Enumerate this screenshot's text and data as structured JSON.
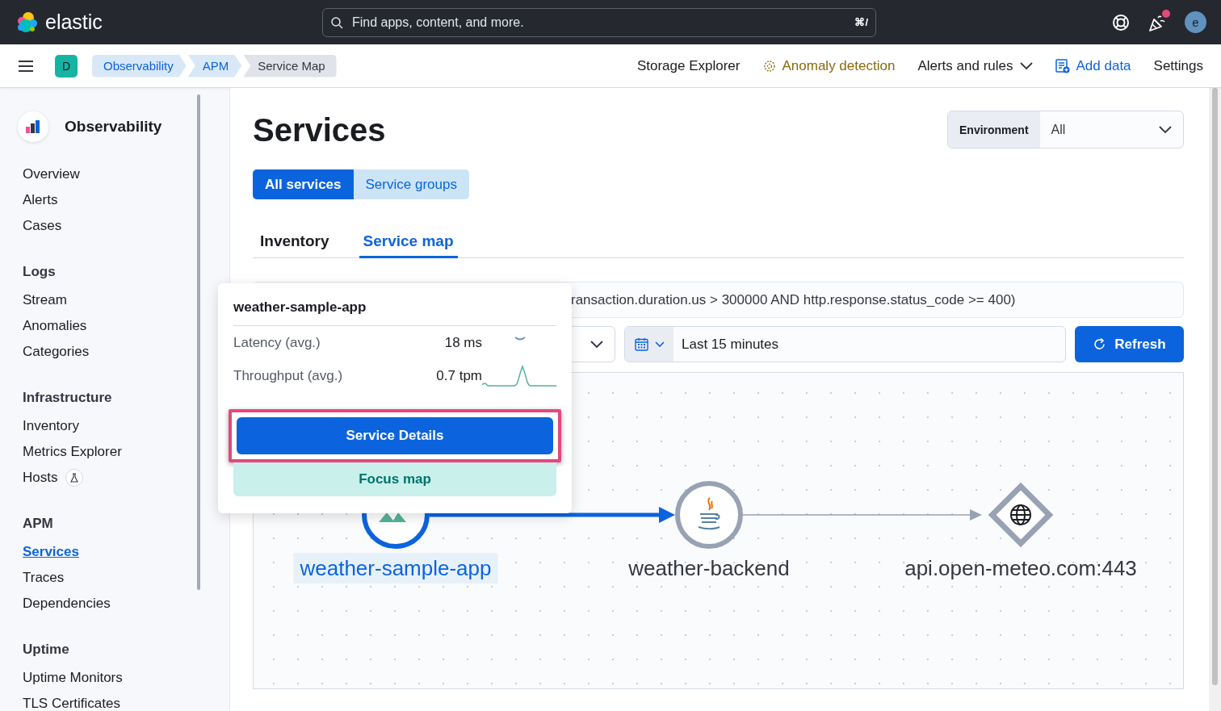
{
  "top_bar": {
    "brand": "elastic",
    "search": {
      "placeholder": "Find apps, content, and more.",
      "shortcut": "⌘/"
    },
    "news_unread": true,
    "avatar": "e"
  },
  "nav_bar": {
    "space": "D",
    "breadcrumbs": [
      "Observability",
      "APM",
      "Service Map"
    ],
    "links": [
      {
        "label": "Storage Explorer",
        "kind": "plain"
      },
      {
        "label": "Anomaly detection",
        "kind": "ml"
      },
      {
        "label": "Alerts and rules",
        "kind": "menu"
      },
      {
        "label": "Add data",
        "kind": "add"
      },
      {
        "label": "Settings",
        "kind": "plain"
      }
    ]
  },
  "sidebar": {
    "title": "Observability",
    "sections": [
      {
        "items": [
          {
            "label": "Overview",
            "selected": false,
            "beta": false
          },
          {
            "label": "Alerts",
            "selected": false,
            "beta": false
          },
          {
            "label": "Cases",
            "selected": false,
            "beta": false
          }
        ]
      },
      {
        "title": "Logs",
        "items": [
          {
            "label": "Stream",
            "selected": false,
            "beta": false
          },
          {
            "label": "Anomalies",
            "selected": false,
            "beta": false
          },
          {
            "label": "Categories",
            "selected": false,
            "beta": false
          }
        ]
      },
      {
        "title": "Infrastructure",
        "items": [
          {
            "label": "Inventory",
            "selected": false,
            "beta": false
          },
          {
            "label": "Metrics Explorer",
            "selected": false,
            "beta": false
          },
          {
            "label": "Hosts",
            "selected": false,
            "beta": true
          }
        ]
      },
      {
        "title": "APM",
        "items": [
          {
            "label": "Services",
            "selected": true,
            "beta": false
          },
          {
            "label": "Traces",
            "selected": false,
            "beta": false
          },
          {
            "label": "Dependencies",
            "selected": false,
            "beta": false
          }
        ]
      },
      {
        "title": "Uptime",
        "items": [
          {
            "label": "Uptime Monitors",
            "selected": false,
            "beta": false
          },
          {
            "label": "TLS Certificates",
            "selected": false,
            "beta": false
          }
        ]
      }
    ]
  },
  "main": {
    "title": "Services",
    "environment": {
      "label": "Environment",
      "value": "All"
    },
    "view_toggle": [
      {
        "label": "All services",
        "selected": true
      },
      {
        "label": "Service groups",
        "selected": false
      }
    ],
    "tabs": [
      {
        "label": "Inventory",
        "selected": false
      },
      {
        "label": "Service map",
        "selected": true
      }
    ],
    "query": "ransaction.duration.us > 300000 AND http.response.status_code >= 400)",
    "time_range": "Last 15 minutes",
    "refresh": "Refresh",
    "service_map": {
      "nodes": [
        {
          "label": "weather-sample-app",
          "kind": "service",
          "selected": true
        },
        {
          "label": "weather-backend",
          "kind": "java",
          "selected": false
        },
        {
          "label": "api.open-meteo.com:443",
          "kind": "external",
          "selected": false
        }
      ]
    },
    "popover": {
      "title": "weather-sample-app",
      "stats": [
        {
          "label": "Latency (avg.)",
          "value": "18 ms"
        },
        {
          "label": "Throughput (avg.)",
          "value": "0.7 tpm"
        }
      ],
      "primary_button": {
        "label": "Service Details",
        "highlighted": true
      },
      "secondary_button": "Focus map"
    }
  }
}
